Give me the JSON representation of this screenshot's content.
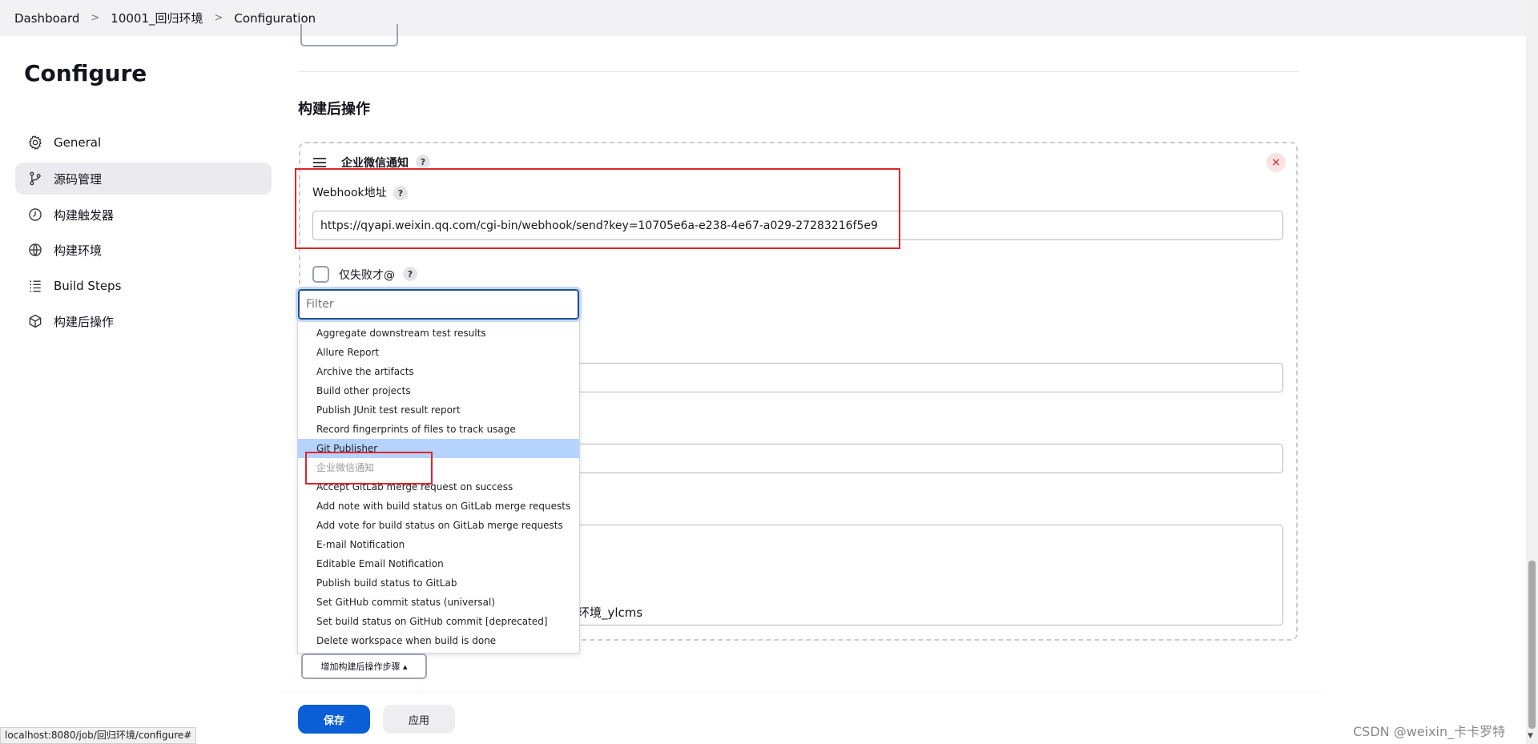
{
  "breadcrumb": {
    "items": [
      "Dashboard",
      "10001_回归环境",
      "Configuration"
    ],
    "separator": ">"
  },
  "sidebar": {
    "title": "Configure",
    "items": [
      {
        "label": "General",
        "icon": "gear-icon"
      },
      {
        "label": "源码管理",
        "icon": "branch-icon",
        "active": true
      },
      {
        "label": "构建触发器",
        "icon": "clock-icon"
      },
      {
        "label": "构建环境",
        "icon": "globe-icon"
      },
      {
        "label": "Build Steps",
        "icon": "list-icon"
      },
      {
        "label": "构建后操作",
        "icon": "cube-icon"
      }
    ]
  },
  "main": {
    "section_title": "构建后操作",
    "panel": {
      "title": "企业微信通知",
      "help": "?",
      "close": "×",
      "webhook_label": "Webhook地址",
      "webhook_value": "https://qyapi.weixin.qq.com/cgi-bin/webhook/send?key=10705e6a-e238-4e67-a029-27283216f5e9",
      "only_failure_label": "仅失败才@",
      "textarea_tail": "环境_ylcms"
    },
    "dropdown": {
      "filter_placeholder": "Filter",
      "options": [
        "Aggregate downstream test results",
        "Allure Report",
        "Archive the artifacts",
        "Build other projects",
        "Publish JUnit test result report",
        "Record fingerprints of files to track usage",
        "Git Publisher",
        "企业微信通知",
        "Accept GitLab merge request on success",
        "Add note with build status on GitLab merge requests",
        "Add vote for build status on GitLab merge requests",
        "E-mail Notification",
        "Editable Email Notification",
        "Publish build status to GitLab",
        "Set GitHub commit status (universal)",
        "Set build status on GitHub commit [deprecated]",
        "Delete workspace when build is done"
      ],
      "highlighted_index": 6,
      "disabled_index": 7
    },
    "add_step_label": "增加构建后操作步骤 ▴"
  },
  "footer": {
    "save_label": "保存",
    "apply_label": "应用"
  },
  "status_url": "localhost:8080/job/回归环境/configure#",
  "watermark": "CSDN @weixin_卡卡罗特",
  "colors": {
    "accent": "#0b5fd6",
    "highlight": "#b5d3ff",
    "annotation": "#e02626",
    "active_nav": "#eaeaef"
  }
}
